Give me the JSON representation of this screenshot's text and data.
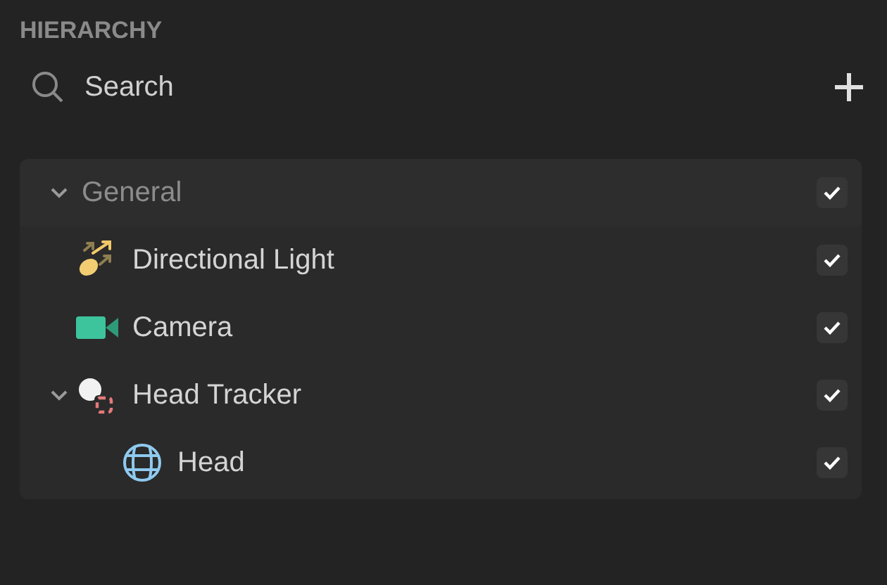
{
  "panel": {
    "title": "HIERARCHY"
  },
  "search": {
    "placeholder": "Search"
  },
  "tree": [
    {
      "label": "General",
      "kind": "group",
      "expanded": true,
      "checked": true,
      "children": [
        {
          "label": "Directional Light",
          "kind": "light",
          "checked": true
        },
        {
          "label": "Camera",
          "kind": "camera",
          "checked": true
        },
        {
          "label": "Head Tracker",
          "kind": "tracker",
          "expanded": true,
          "checked": true,
          "children": [
            {
              "label": "Head",
              "kind": "mesh",
              "checked": true
            }
          ]
        }
      ]
    }
  ]
}
